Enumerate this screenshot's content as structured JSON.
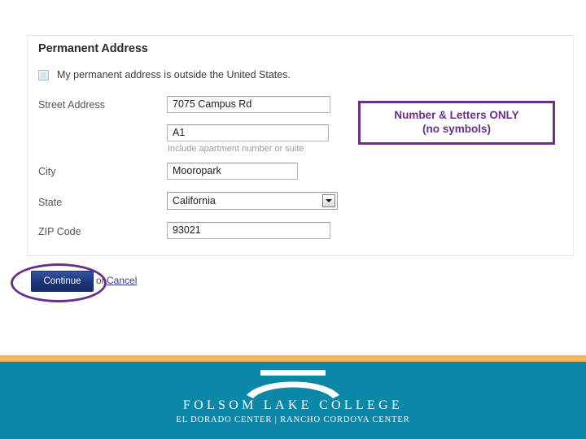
{
  "panel": {
    "title": "Permanent Address",
    "outside_us_label": "My permanent address is outside the United States.",
    "fields": {
      "street_address_label": "Street Address",
      "street_address_value": "7075 Campus Rd",
      "street_address_2_value": "A1",
      "street_address_2_helper": "Include apartment number or suite",
      "city_label": "City",
      "city_value": "Mooropark",
      "state_label": "State",
      "state_value": "California",
      "zip_label": "ZIP Code",
      "zip_value": "93021"
    }
  },
  "actions": {
    "continue_label": "Continue",
    "or_label": "or",
    "cancel_label": "Cancel"
  },
  "annotations": {
    "callout_line_1": "Number & Letters  ONLY",
    "callout_line_2": "(no symbols)",
    "accent_color": "#6b2f88"
  },
  "footer": {
    "college_name": "FOLSOM LAKE COLLEGE",
    "centers": "EL DORADO CENTER | RANCHO CORDOVA CENTER",
    "band_color": "#0d87a8",
    "stripe_color": "#f4b852"
  }
}
